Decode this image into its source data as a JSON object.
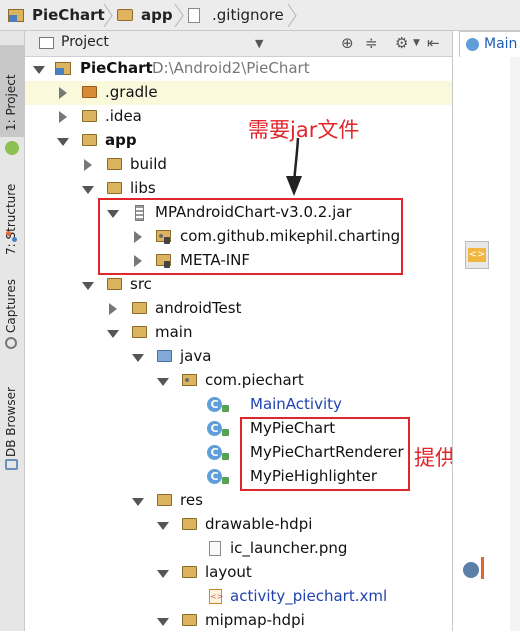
{
  "breadcrumbs": [
    "PieChart",
    "app",
    ".gitignore"
  ],
  "tool_strip": {
    "tabs": [
      "1: Project",
      "7: Structure",
      "Captures",
      "DB Browser"
    ]
  },
  "project_panel": {
    "title": "Project",
    "dropdown": "Project",
    "icons": [
      "target-icon",
      "collapse-icon",
      "gear-icon",
      "hide-icon"
    ]
  },
  "tree": [
    {
      "label": "PieChart",
      "path": "D:\\Android2\\PieChart",
      "icon": "project-folder-icon",
      "expanded": true,
      "bold": true
    },
    {
      "label": ".gradle",
      "icon": "folder-orange-icon",
      "expanded": false
    },
    {
      "label": ".idea",
      "icon": "folder-icon",
      "expanded": false
    },
    {
      "label": "app",
      "icon": "module-folder-icon",
      "expanded": true,
      "bold": true
    },
    {
      "label": "build",
      "icon": "folder-icon",
      "expanded": false
    },
    {
      "label": "libs",
      "icon": "folder-icon",
      "expanded": true
    },
    {
      "label": "MPAndroidChart-v3.0.2.jar",
      "icon": "jar-icon",
      "expanded": true
    },
    {
      "label": "com.github.mikephil.charting",
      "icon": "package-icon",
      "expanded": false
    },
    {
      "label": "META-INF",
      "icon": "folder-icon",
      "expanded": false
    },
    {
      "label": "src",
      "icon": "folder-icon",
      "expanded": true
    },
    {
      "label": "androidTest",
      "icon": "folder-icon",
      "expanded": false
    },
    {
      "label": "main",
      "icon": "folder-icon",
      "expanded": true
    },
    {
      "label": "java",
      "icon": "folder-blue-icon",
      "expanded": true
    },
    {
      "label": "com.piechart",
      "icon": "package-icon",
      "expanded": true
    },
    {
      "label": "MainActivity",
      "icon": "class-icon",
      "blue": true
    },
    {
      "label": "MyPieChart",
      "icon": "class-icon"
    },
    {
      "label": "MyPieChartRenderer",
      "icon": "class-icon"
    },
    {
      "label": "MyPieHighlighter",
      "icon": "class-icon"
    },
    {
      "label": "res",
      "icon": "res-folder-icon",
      "expanded": true
    },
    {
      "label": "drawable-hdpi",
      "icon": "folder-icon",
      "expanded": true
    },
    {
      "label": "ic_launcher.png",
      "icon": "image-file-icon"
    },
    {
      "label": "layout",
      "icon": "folder-icon",
      "expanded": true
    },
    {
      "label": "activity_piechart.xml",
      "icon": "xml-file-icon",
      "blue": true
    },
    {
      "label": "mipmap-hdpi",
      "icon": "folder-icon",
      "expanded": true
    }
  ],
  "annotations": {
    "need_jar": "需要jar文件",
    "provide_code": "提供代码"
  },
  "editor": {
    "tab_label": "Main"
  },
  "colors": {
    "annotation_red": "#e0262b",
    "highlight_row": "#fbf9dc",
    "link_blue": "#2043b0"
  }
}
